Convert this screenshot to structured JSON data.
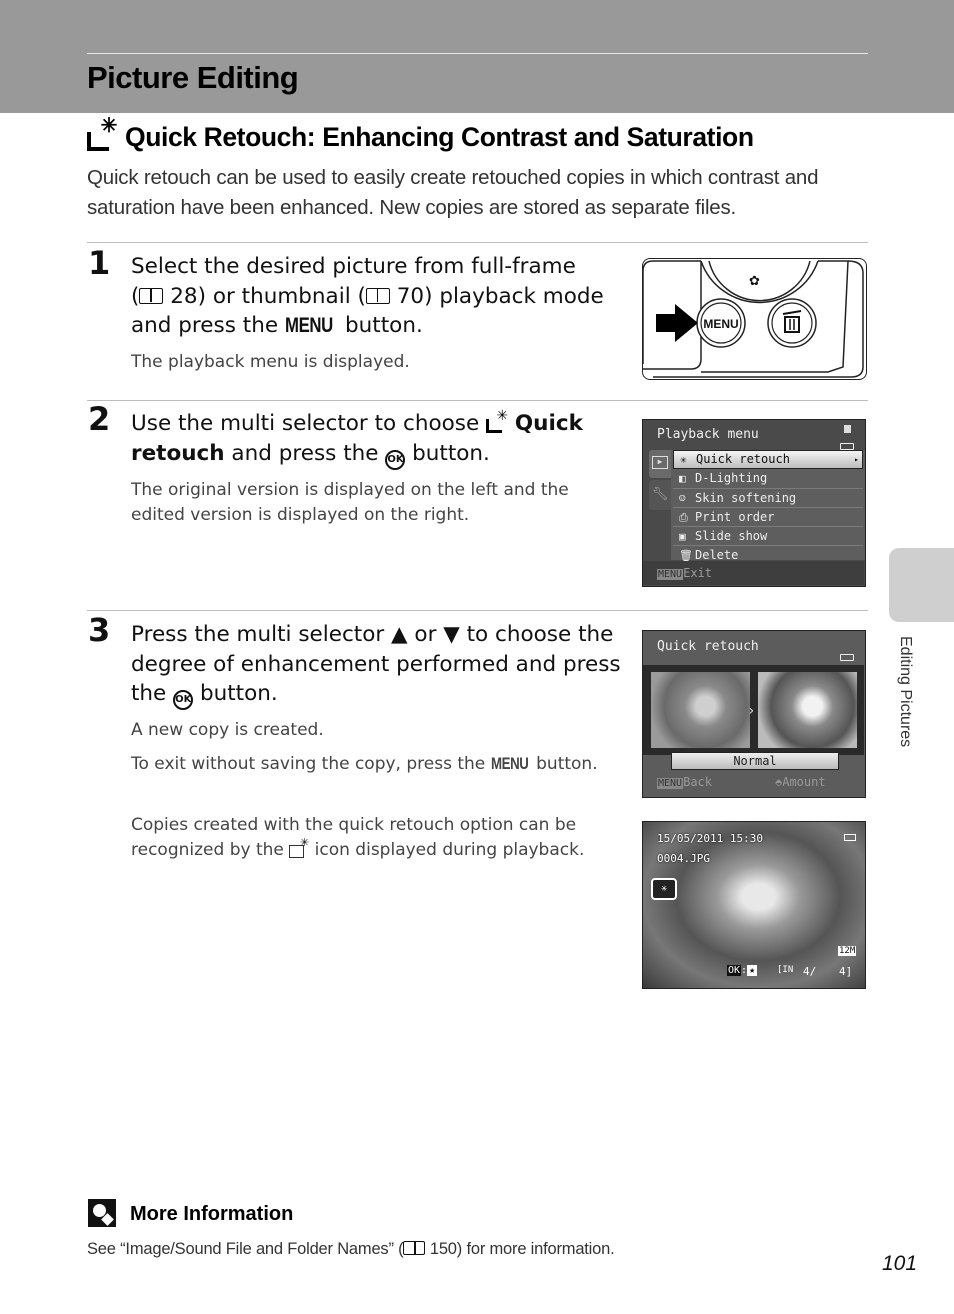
{
  "header": {
    "page_title": "Picture Editing"
  },
  "section": {
    "icon": "quick-retouch-icon",
    "title": "Quick Retouch: Enhancing Contrast and Saturation",
    "intro": "Quick retouch can be used to easily create retouched copies in which contrast and saturation have been enhanced. New copies are stored as separate files."
  },
  "steps": [
    {
      "number": "1",
      "line1": "Select the desired picture from full-frame",
      "ref1_open": "(",
      "ref1_page": "28",
      "ref1_mid": ") or thumbnail (",
      "ref2_page": "70",
      "ref2_close": ") playback mode",
      "line3_pre": "and press the ",
      "menu_word": "MENU",
      "line3_post": " button.",
      "note": "The playback menu is displayed."
    },
    {
      "number": "2",
      "pre": "Use the multi selector to choose ",
      "bold1": "Quick",
      "bold2": "retouch",
      "post": " and press the ",
      "ok": "OK",
      "post2": " button.",
      "note": "The original version is displayed on the left and the edited version is displayed on the right."
    },
    {
      "number": "3",
      "pre": "Press the multi selector ",
      "up": "▲",
      "or": " or ",
      "down": "▼",
      "post": " to choose the degree of enhancement performed and press the ",
      "ok": "OK",
      "post2": " button.",
      "note1": "A new copy is created.",
      "note2_pre": "To exit without saving the copy, press the ",
      "note2_menu": "MENU",
      "note2_post": " button.",
      "note3_pre": "Copies created with the quick retouch option can be recognized by the ",
      "note3_post": " icon displayed during playback."
    }
  ],
  "camera_buttons": {
    "menu_label": "MENU",
    "delete_icon": "trash-icon",
    "macro_icon": "flower-icon"
  },
  "playback_menu": {
    "title": "Playback menu",
    "items": [
      {
        "icon": "quick-retouch-icon",
        "label": "Quick retouch",
        "selected": true
      },
      {
        "icon": "d-lighting-icon",
        "label": "D-Lighting",
        "selected": false
      },
      {
        "icon": "skin-softening-icon",
        "label": "Skin softening",
        "selected": false
      },
      {
        "icon": "print-order-icon",
        "label": "Print order",
        "selected": false
      },
      {
        "icon": "slide-show-icon",
        "label": "Slide show",
        "selected": false
      },
      {
        "icon": "delete-icon",
        "label": "Delete",
        "selected": false
      }
    ],
    "footer_key": "MENU",
    "footer_label": "Exit"
  },
  "quick_retouch_screen": {
    "title": "Quick retouch",
    "amount_value": "Normal",
    "back_key": "MENU",
    "back_label": "Back",
    "amount_label": "Amount"
  },
  "playback_screen": {
    "datetime": "15/05/2011 15:30",
    "filename": "0004.JPG",
    "image_size": "12M",
    "ok_hint": "OK",
    "frame_current": "4/",
    "frame_total": "4]",
    "memory": "IN"
  },
  "side_tab": {
    "label": "Editing Pictures"
  },
  "more_info": {
    "title": "More Information",
    "text_pre": "See “Image/Sound File and Folder Names” (",
    "ref_page": "150",
    "text_post": ") for more information."
  },
  "page_number": "101"
}
